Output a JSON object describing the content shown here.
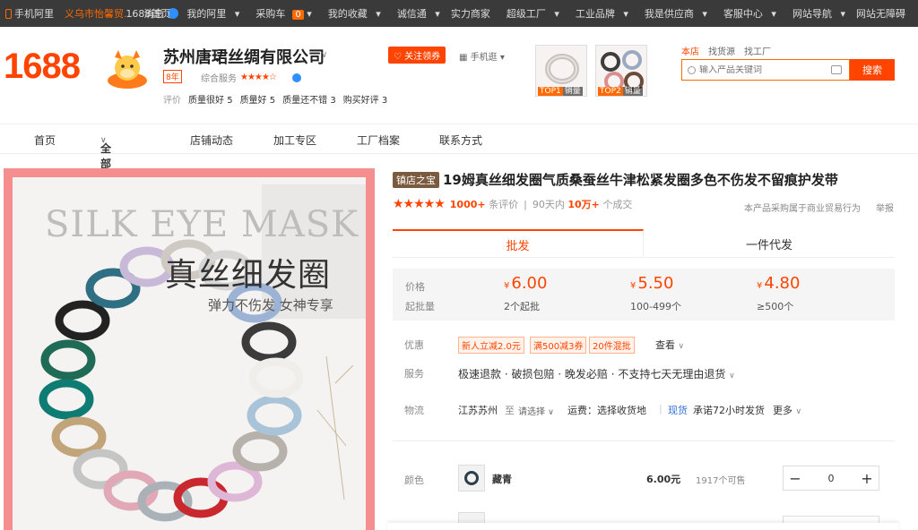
{
  "topbar": {
    "mobile": "手机阿里",
    "store": "义乌市怡馨贸...",
    "message": "消息",
    "links": [
      "1688首页",
      "我的阿里",
      "采购车",
      "我的收藏",
      "诚信通",
      "实力商家",
      "超级工厂",
      "工业品牌",
      "我是供应商",
      "客服中心",
      "网站导航",
      "网站无障碍"
    ],
    "cart_count": "0"
  },
  "header": {
    "logo": "1688",
    "company_name": "苏州唐珺丝绸有限公司",
    "years": "8年",
    "service_label": "综合服务",
    "service_stars": "★★★★☆",
    "eval_label": "评价",
    "evals": [
      {
        "label": "质量很好",
        "count": "5"
      },
      {
        "label": "质量好",
        "count": "5"
      },
      {
        "label": "质量还不错",
        "count": "3"
      },
      {
        "label": "购买好评",
        "count": "3"
      }
    ],
    "follow": "关注领券",
    "mobile_browse": "手机逛",
    "top_items": [
      {
        "rank": "TOP1",
        "sales": "销量"
      },
      {
        "rank": "TOP2",
        "sales": "销量"
      }
    ],
    "search_tabs": [
      "本店",
      "找货源",
      "找工厂"
    ],
    "search_placeholder": "输入产品关键词",
    "search_button": "搜索"
  },
  "nav": {
    "items": [
      "首页",
      "全部商品",
      "店铺动态",
      "加工专区",
      "工厂档案",
      "联系方式"
    ]
  },
  "product_image": {
    "title_en": "SILK EYE MASK",
    "title_cn": "真丝细发圈",
    "subtitle": "弹力不伤发 女神专享"
  },
  "product": {
    "badge": "镇店之宝",
    "title": "19姆真丝细发圈气质桑蚕丝牛津松紧发圈多色不伤发不留痕护发带",
    "stars": "★★★★★",
    "review_count": "1000+",
    "review_label": "条评价",
    "deal_period": "90天内",
    "deal_count": "10万+",
    "deal_label": "个成交",
    "note": "本产品采购属于商业贸易行为",
    "report": "举报",
    "tabs": [
      "批发",
      "一件代发"
    ],
    "price_label": "价格",
    "moq_label": "起批量",
    "currency": "¥",
    "prices": [
      {
        "price": "6.00",
        "qty": "2个起批"
      },
      {
        "price": "5.50",
        "qty": "100-499个"
      },
      {
        "price": "4.80",
        "qty": "≥500个"
      }
    ],
    "promo_label": "优惠",
    "coupons": [
      "新人立减2.0元",
      "满500减3券",
      "20件混批"
    ],
    "view_more": "查看",
    "service_label": "服务",
    "service_text": "极速退款 · 破损包赔 · 晚发必赔 · 不支持七天无理由退货",
    "logistics_label": "物流",
    "origin": "江苏苏州",
    "to": "至",
    "select": "请选择",
    "freight": "运费：选择收货地",
    "in_stock": "现货",
    "ship_promise": "承诺72小时发货",
    "more": "更多",
    "color_label": "颜色",
    "variants": [
      {
        "name": "藏青",
        "price": "6.00元",
        "stock": "1917个可售",
        "qty": "0"
      }
    ]
  },
  "colors": {
    "accent": "#ff4400",
    "topbar": "#3a3a3a",
    "frame": "#f58e8e"
  }
}
